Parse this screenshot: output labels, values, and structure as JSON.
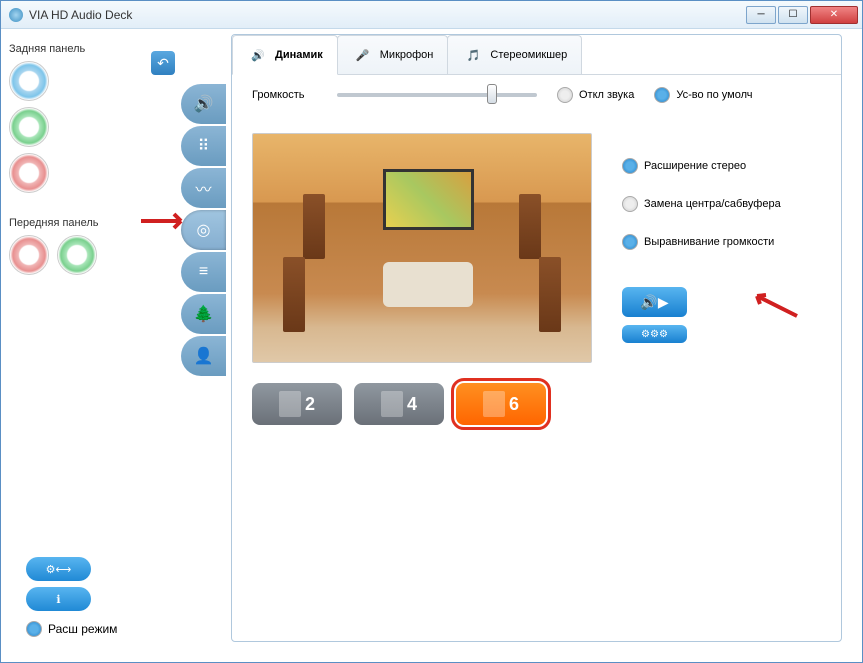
{
  "window": {
    "title": "VIA HD Audio Deck"
  },
  "sidebar": {
    "rear_panel_label": "Задняя панель",
    "front_panel_label": "Передняя панель"
  },
  "bottom": {
    "expand_mode": "Расш режим"
  },
  "tabs": [
    {
      "label": "Динамик",
      "icon": "speaker"
    },
    {
      "label": "Микрофон",
      "icon": "microphone"
    },
    {
      "label": "Стереомикшер",
      "icon": "mixer"
    }
  ],
  "volume": {
    "label": "Громкость",
    "mute_label": "Откл звука",
    "default_device_label": "Ус-во по умолч"
  },
  "options": {
    "stereo_expand": "Расширение стерео",
    "swap_center": "Замена центра/сабвуфера",
    "volume_level": "Выравнивание громкости"
  },
  "configs": {
    "c2": "2",
    "c4": "4",
    "c6": "6"
  }
}
